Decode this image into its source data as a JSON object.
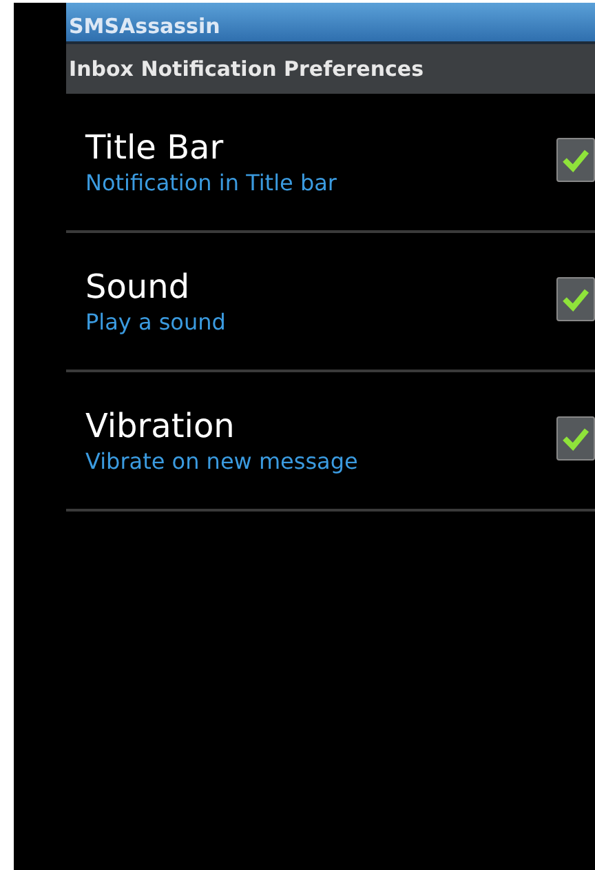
{
  "app_bar": {
    "title": "SMSAssassin"
  },
  "header": {
    "title": "Inbox Notification Preferences"
  },
  "preferences": [
    {
      "title": "Title Bar",
      "summary": "Notification in Title bar",
      "checked": true
    },
    {
      "title": "Sound",
      "summary": "Play a sound",
      "checked": true
    },
    {
      "title": "Vibration",
      "summary": "Vibrate on new message",
      "checked": true
    }
  ]
}
